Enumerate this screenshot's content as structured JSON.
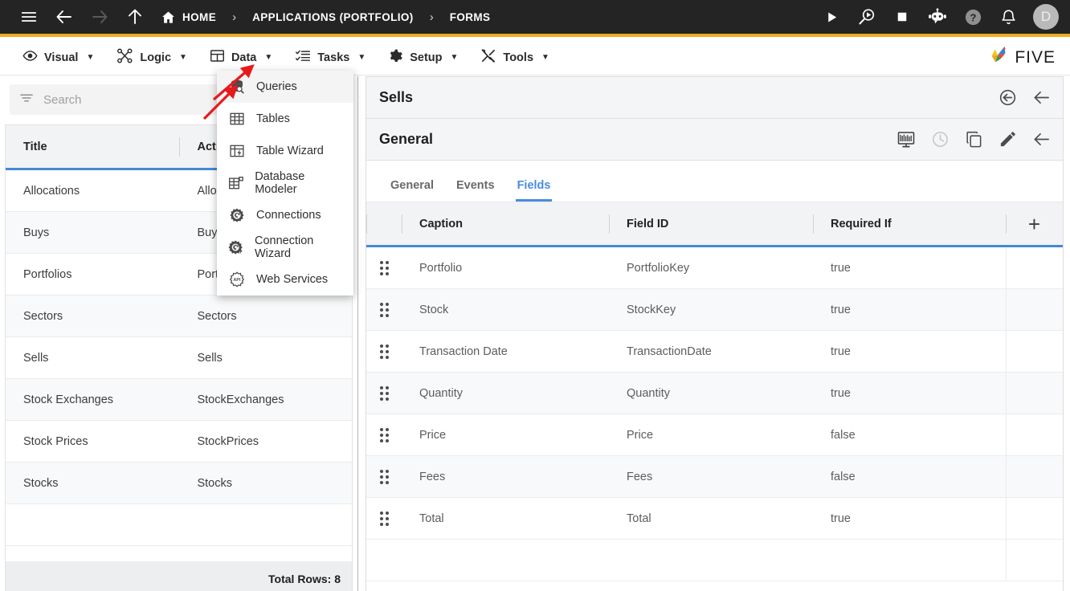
{
  "topbar": {
    "menu_icon": "hamburger-icon",
    "back_icon": "arrow-left-icon",
    "forward_icon": "arrow-right-icon",
    "up_icon": "arrow-up-icon",
    "breadcrumbs": [
      {
        "label": "HOME",
        "icon": "home-icon"
      },
      {
        "label": "APPLICATIONS (PORTFOLIO)",
        "icon": ""
      },
      {
        "label": "FORMS",
        "icon": ""
      }
    ],
    "separator": "›",
    "actions": [
      {
        "name": "run-icon",
        "glyph": "play"
      },
      {
        "name": "debug-search-icon",
        "glyph": "search-play"
      },
      {
        "name": "stop-icon",
        "glyph": "square"
      },
      {
        "name": "chatbot-icon",
        "glyph": "robot"
      },
      {
        "name": "help-icon",
        "glyph": "question"
      },
      {
        "name": "notifications-icon",
        "glyph": "bell"
      }
    ],
    "avatar_letter": "D",
    "accent_color": "#f0ad1f",
    "background_color": "#242424"
  },
  "menubar": {
    "items": [
      {
        "label": "Visual",
        "icon": "eye-icon",
        "caret": "▼"
      },
      {
        "label": "Logic",
        "icon": "logic-nodes-icon",
        "caret": "▼"
      },
      {
        "label": "Data",
        "icon": "table-grid-icon",
        "caret": "▼"
      },
      {
        "label": "Tasks",
        "icon": "checklist-icon",
        "caret": "▼"
      },
      {
        "label": "Setup",
        "icon": "gear-icon",
        "caret": "▼"
      },
      {
        "label": "Tools",
        "icon": "tools-icon",
        "caret": "▼"
      }
    ],
    "logo_text": "FIVE"
  },
  "data_menu": {
    "items": [
      {
        "label": "Queries",
        "icon": "database-search-icon",
        "highlighted": true
      },
      {
        "label": "Tables",
        "icon": "table-icon",
        "highlighted": false
      },
      {
        "label": "Table Wizard",
        "icon": "table-wizard-icon",
        "highlighted": false
      },
      {
        "label": "Database Modeler",
        "icon": "database-modeler-icon",
        "highlighted": false
      },
      {
        "label": "Connections",
        "icon": "connection-gear-icon",
        "highlighted": false
      },
      {
        "label": "Connection Wizard",
        "icon": "connection-wizard-icon",
        "highlighted": false
      },
      {
        "label": "Web Services",
        "icon": "api-icon",
        "highlighted": false
      }
    ]
  },
  "left_panel": {
    "search": {
      "placeholder": "Search",
      "value": "",
      "icon": "filter-icon"
    },
    "columns": [
      "Title",
      "Action"
    ],
    "rows": [
      {
        "title": "Allocations",
        "action": "Allocations"
      },
      {
        "title": "Buys",
        "action": "Buys"
      },
      {
        "title": "Portfolios",
        "action": "Portfolios"
      },
      {
        "title": "Sectors",
        "action": "Sectors"
      },
      {
        "title": "Sells",
        "action": "Sells"
      },
      {
        "title": "Stock Exchanges",
        "action": "StockExchanges"
      },
      {
        "title": "Stock Prices",
        "action": "StockPrices"
      },
      {
        "title": "Stocks",
        "action": "Stocks"
      }
    ],
    "footer": "Total Rows: 8"
  },
  "right_panel": {
    "record_title": "Sells",
    "record_icons": [
      {
        "name": "revert-circle-icon"
      },
      {
        "name": "back-arrow-icon"
      }
    ],
    "section_title": "General",
    "section_icons": [
      {
        "name": "display-preview-icon"
      },
      {
        "name": "history-clock-icon"
      },
      {
        "name": "duplicate-icon"
      },
      {
        "name": "edit-pencil-icon"
      },
      {
        "name": "back-arrow-icon"
      }
    ],
    "tabs": [
      {
        "label": "General",
        "active": false
      },
      {
        "label": "Events",
        "active": false
      },
      {
        "label": "Fields",
        "active": true
      }
    ],
    "fields_table": {
      "columns": [
        "Caption",
        "Field ID",
        "Required If"
      ],
      "add_label": "+",
      "rows": [
        {
          "caption": "Portfolio",
          "field_id": "PortfolioKey",
          "required_if": "true"
        },
        {
          "caption": "Stock",
          "field_id": "StockKey",
          "required_if": "true"
        },
        {
          "caption": "Transaction Date",
          "field_id": "TransactionDate",
          "required_if": "true"
        },
        {
          "caption": "Quantity",
          "field_id": "Quantity",
          "required_if": "true"
        },
        {
          "caption": "Price",
          "field_id": "Price",
          "required_if": "false"
        },
        {
          "caption": "Fees",
          "field_id": "Fees",
          "required_if": "false"
        },
        {
          "caption": "Total",
          "field_id": "Total",
          "required_if": "true"
        }
      ]
    }
  },
  "annotations": {
    "arrow_color": "#e8191b",
    "arrows": [
      {
        "name": "arrow-pointing-data-menu"
      },
      {
        "name": "arrow-pointing-queries-item"
      }
    ]
  }
}
